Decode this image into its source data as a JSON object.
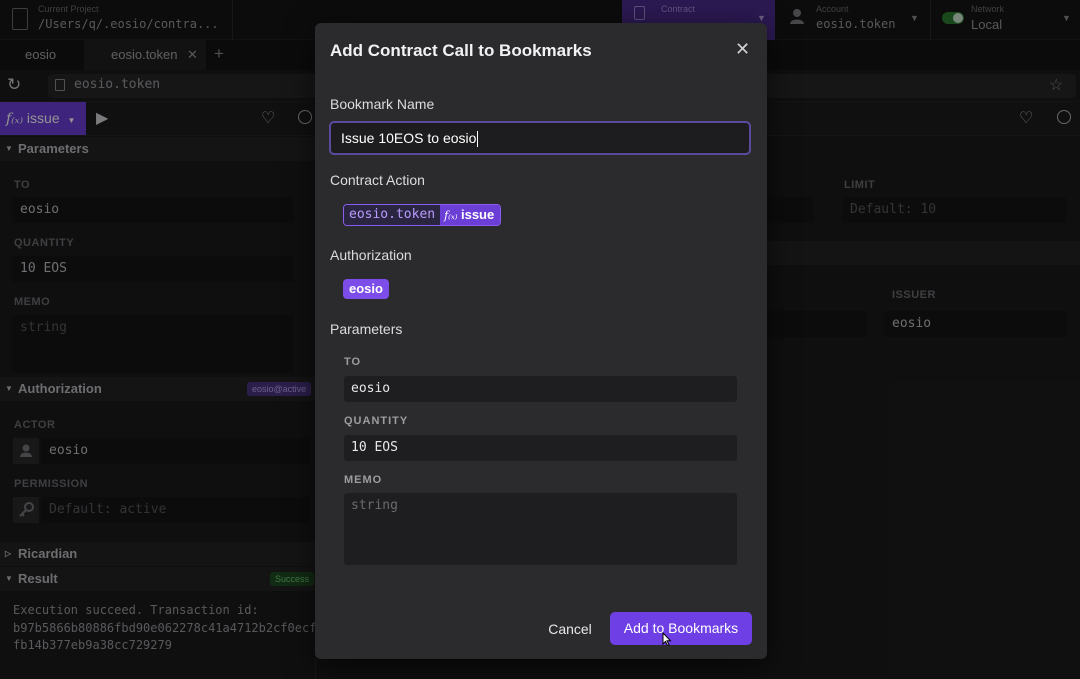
{
  "topbar": {
    "current_project_label": "Current Project",
    "current_project_value": "/Users/q/.eosio/contra...",
    "contract_label": "Contract",
    "account_label": "Account",
    "account_value": "eosio.token",
    "network_label": "Network",
    "network_value": "Local"
  },
  "tabs": [
    {
      "label": "eosio"
    },
    {
      "label": "eosio.token"
    }
  ],
  "address": {
    "value": "eosio.token"
  },
  "toolbar": {
    "function_label": "issue"
  },
  "left_panel": {
    "parameters_title": "Parameters",
    "to_label": "TO",
    "to_value": "eosio",
    "quantity_label": "QUANTITY",
    "quantity_value": "10 EOS",
    "memo_label": "MEMO",
    "memo_placeholder": "string",
    "authorization_title": "Authorization",
    "authorization_badge": "eosio@active",
    "actor_label": "ACTOR",
    "actor_value": "eosio",
    "permission_label": "PERMISSION",
    "permission_placeholder": "Default: active",
    "ricardian_title": "Ricardian",
    "result_title": "Result",
    "result_badge": "Success",
    "result_line1": "Execution succeed. Transaction id:",
    "result_line2": "b97b5866b80886fbd90e062278c41a4712b2cf0ecf",
    "result_line3": "fb14b377eb9a38cc729279"
  },
  "right_panel": {
    "limit_label": "LIMIT",
    "limit_placeholder": "Default: 10",
    "issuer_label": "ISSUER",
    "issuer_value": "eosio"
  },
  "modal": {
    "title": "Add Contract Call to Bookmarks",
    "close_glyph": "✕",
    "bookmark_name_label": "Bookmark Name",
    "bookmark_name_value": "Issue 10EOS to eosio",
    "contract_action_label": "Contract Action",
    "contract_name": "eosio.token",
    "action_name": "issue",
    "authorization_label": "Authorization",
    "authorization_value": "eosio",
    "parameters_label": "Parameters",
    "to_label": "TO",
    "to_value": "eosio",
    "quantity_label": "QUANTITY",
    "quantity_value": "10 EOS",
    "memo_label": "MEMO",
    "memo_placeholder": "string",
    "cancel_label": "Cancel",
    "add_label": "Add to Bookmarks"
  },
  "colors": {
    "accent": "#6f3fe6",
    "modal_bg": "#2b2b2d",
    "success": "#2e7d32"
  },
  "icons": [
    "file-icon",
    "document-icon",
    "user-icon",
    "toggle-switch",
    "close-tab-icon",
    "plus-icon",
    "refresh-icon",
    "page-icon",
    "star-icon",
    "function-icon",
    "play-icon",
    "heart-icon",
    "history-icon",
    "caret-down-icon",
    "key-icon",
    "close-icon",
    "pointer-cursor-icon"
  ]
}
